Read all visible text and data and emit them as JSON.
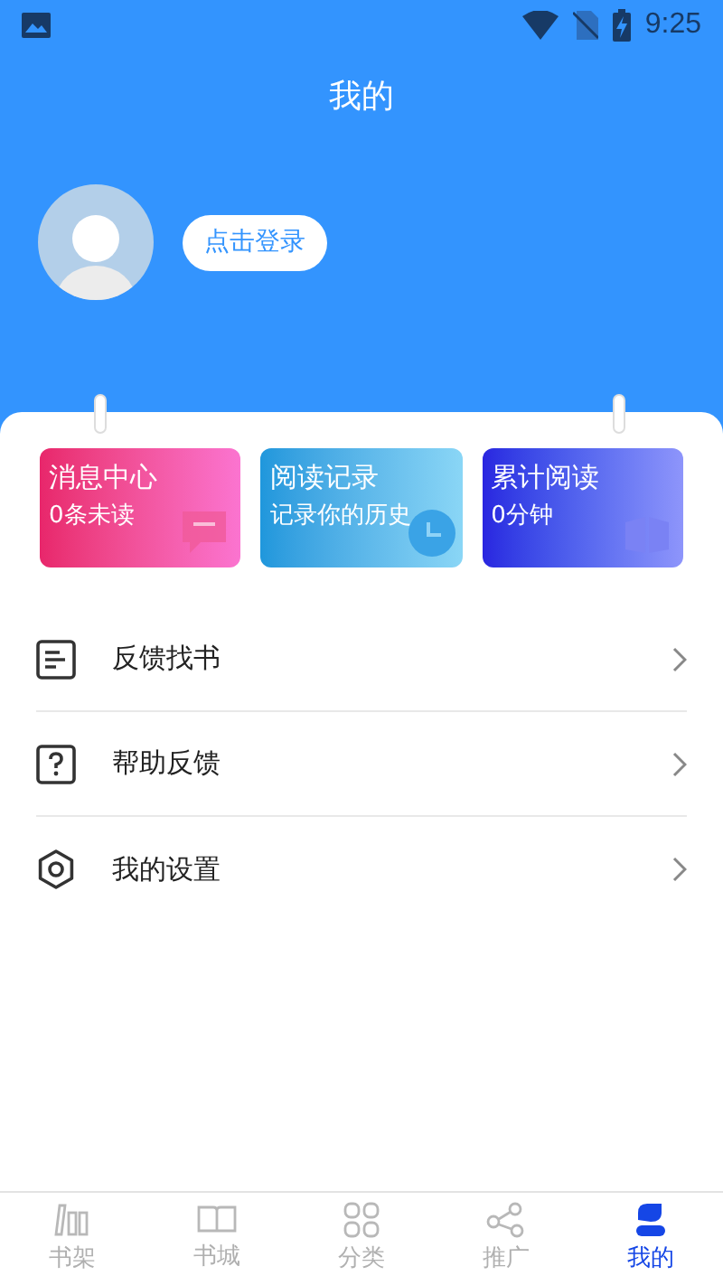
{
  "status_bar": {
    "time": "9:25"
  },
  "header": {
    "title": "我的",
    "login_button": "点击登录"
  },
  "cards": [
    {
      "kind": "message",
      "title": "消息中心",
      "subtitle": "0条未读"
    },
    {
      "kind": "history",
      "title": "阅读记录",
      "subtitle": "记录你的历史"
    },
    {
      "kind": "total",
      "title": "累计阅读",
      "subtitle": "0分钟"
    }
  ],
  "menu": [
    {
      "kind": "feedback",
      "label": "反馈找书"
    },
    {
      "kind": "help",
      "label": "帮助反馈"
    },
    {
      "kind": "settings",
      "label": "我的设置"
    }
  ],
  "tabs": [
    {
      "kind": "shelf",
      "label": "书架",
      "selected": false
    },
    {
      "kind": "store",
      "label": "书城",
      "selected": false
    },
    {
      "kind": "category",
      "label": "分类",
      "selected": false
    },
    {
      "kind": "share",
      "label": "推广",
      "selected": false
    },
    {
      "kind": "me",
      "label": "我的",
      "selected": true
    }
  ]
}
